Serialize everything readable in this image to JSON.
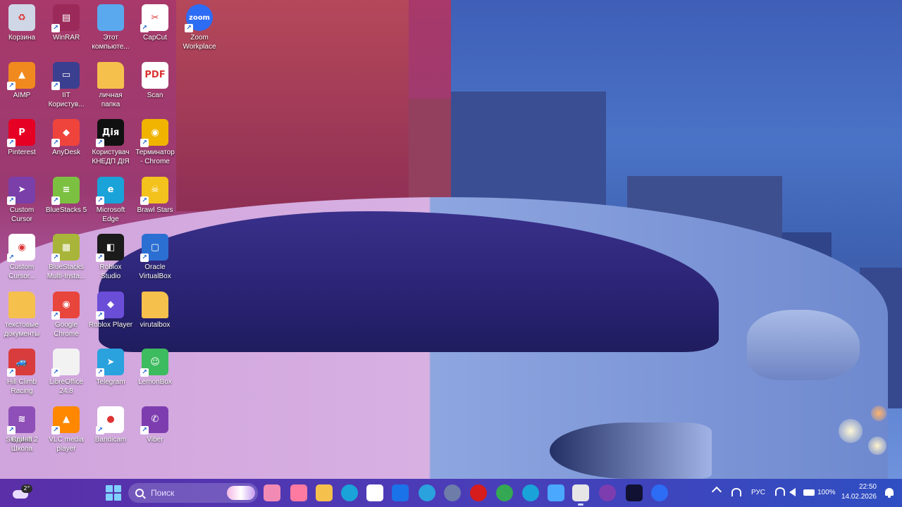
{
  "desktop": {
    "icons": [
      {
        "label": "Корзина",
        "icon": "recycle-bin-icon",
        "color": "#cfd6e6",
        "text": "♻",
        "shortcut": false
      },
      {
        "label": "WinRAR",
        "icon": "winrar-icon",
        "color": "#9b2a5a",
        "text": "▤",
        "shortcut": true
      },
      {
        "label": "Этот\nкомпьюте...",
        "icon": "this-pc-icon",
        "color": "#5aa9ef",
        "text": "",
        "shortcut": false
      },
      {
        "label": "CapCut",
        "icon": "capcut-icon",
        "color": "#ffffff",
        "text": "✂",
        "shortcut": true
      },
      {
        "label": "Zoom\nWorkplace",
        "icon": "zoom-icon",
        "color": "#2d6cf5",
        "text": "zoom",
        "shortcut": true
      },
      {
        "label": "AIMP",
        "icon": "aimp-icon",
        "color": "#f18a1e",
        "text": "▲",
        "shortcut": true
      },
      {
        "label": "IIT\nКористув...",
        "icon": "iit-user-icon",
        "color": "#3b3f8f",
        "text": "▭",
        "shortcut": true
      },
      {
        "label": "личная\nпапка",
        "icon": "folder-icon",
        "color": "#f6c04d",
        "text": "",
        "shortcut": false
      },
      {
        "label": "Scan",
        "icon": "pdf-file-icon",
        "color": "#ffffff",
        "text": "PDF",
        "shortcut": false
      },
      {
        "label": "Pinterest",
        "icon": "pinterest-icon",
        "color": "#e60023",
        "text": "P",
        "shortcut": true
      },
      {
        "label": "AnyDesk",
        "icon": "anydesk-icon",
        "color": "#ef443b",
        "text": "◆",
        "shortcut": true
      },
      {
        "label": "Користувач\nКНЕДП ДІЯ",
        "icon": "diia-icon",
        "color": "#111111",
        "text": "Дія",
        "shortcut": true
      },
      {
        "label": "Терминатор\n- Chrome",
        "icon": "chrome-icon",
        "color": "#f0b400",
        "text": "◉",
        "shortcut": true
      },
      {
        "label": "Custom\nCursor",
        "icon": "custom-cursor-icon",
        "color": "#7a3fa8",
        "text": "➤",
        "shortcut": true
      },
      {
        "label": "BlueStacks 5",
        "icon": "bluestacks-icon",
        "color": "#7cc041",
        "text": "≡",
        "shortcut": true
      },
      {
        "label": "Microsoft\nEdge",
        "icon": "edge-icon",
        "color": "#1aa3d8",
        "text": "e",
        "shortcut": true
      },
      {
        "label": "Brawl Stars",
        "icon": "brawl-stars-icon",
        "color": "#f3c21c",
        "text": "☠",
        "shortcut": true
      },
      {
        "label": "Custom\nCursor...",
        "icon": "chrome-doc-icon",
        "color": "#ffffff",
        "text": "◉",
        "shortcut": true
      },
      {
        "label": "BlueStacks\nMulti-Insta...",
        "icon": "bluestacks-multi-icon",
        "color": "#a8b53a",
        "text": "▦",
        "shortcut": true
      },
      {
        "label": "Roblox\nStudio",
        "icon": "roblox-studio-icon",
        "color": "#1b1b1b",
        "text": "◧",
        "shortcut": true
      },
      {
        "label": "Oracle\nVirtualBox",
        "icon": "virtualbox-icon",
        "color": "#2c6fd2",
        "text": "▢",
        "shortcut": true
      },
      {
        "label": "текстовые\nдокументы",
        "icon": "folder-icon",
        "color": "#f6c04d",
        "text": "",
        "shortcut": false
      },
      {
        "label": "Google\nChrome",
        "icon": "chrome-icon",
        "color": "#e8453c",
        "text": "◉",
        "shortcut": true
      },
      {
        "label": "Roblox Player",
        "icon": "roblox-player-icon",
        "color": "#6b4ed8",
        "text": "◆",
        "shortcut": true
      },
      {
        "label": "virutalbox",
        "icon": "folder-icon",
        "color": "#f6c04d",
        "text": "",
        "shortcut": false
      },
      {
        "label": "Hill Climb\nRacing",
        "icon": "hill-climb-icon",
        "color": "#d93c3c",
        "text": "🚙",
        "shortcut": true
      },
      {
        "label": "LibreOffice\n24.8",
        "icon": "libreoffice-icon",
        "color": "#f2f2f2",
        "text": "",
        "shortcut": true
      },
      {
        "label": "Telegram",
        "icon": "telegram-icon",
        "color": "#2aa2de",
        "text": "➤",
        "shortcut": true
      },
      {
        "label": "LemonBox",
        "icon": "lemonbox-icon",
        "color": "#3dbb5f",
        "text": "☺",
        "shortcut": true
      },
      {
        "label": "Standoff 2",
        "icon": "standoff-icon",
        "color": "#b5303a",
        "text": "☻",
        "shortcut": true
      },
      {
        "label": "VLC media\nplayer",
        "icon": "vlc-icon",
        "color": "#ff8800",
        "text": "▲",
        "shortcut": true
      },
      {
        "label": "Bandicam",
        "icon": "bandicam-icon",
        "color": "#ffffff",
        "text": "●",
        "shortcut": true
      },
      {
        "label": "Viber",
        "icon": "viber-icon",
        "color": "#7d3daf",
        "text": "✆",
        "shortcut": true
      },
      {
        "label": "Єдина\nШкола",
        "icon": "edyna-shkola-icon",
        "color": "#8e4fb8",
        "text": "≋",
        "shortcut": true
      }
    ]
  },
  "taskbar": {
    "widget_badge": "2°",
    "search_placeholder": "Поиск",
    "apps": [
      {
        "icon": "task-view-icon",
        "color": "#f28bb3"
      },
      {
        "icon": "copilot-icon",
        "color": "#ff7aa0"
      },
      {
        "icon": "file-explorer-icon",
        "color": "#f6c04d"
      },
      {
        "icon": "edge-icon",
        "color": "#1aa3d8"
      },
      {
        "icon": "microsoft-store-icon",
        "color": "#ffffff"
      },
      {
        "icon": "outlook-icon",
        "color": "#1a73e8"
      },
      {
        "icon": "telegram-icon",
        "color": "#2aa2de"
      },
      {
        "icon": "settings-icon",
        "color": "#6d7ca8"
      },
      {
        "icon": "bandicam-icon",
        "color": "#d61c1c"
      },
      {
        "icon": "chrome-icon",
        "color": "#34a853"
      },
      {
        "icon": "edge-dev-icon",
        "color": "#1aa3d8"
      },
      {
        "icon": "onedrive-icon",
        "color": "#4aa8ff"
      },
      {
        "icon": "notepad-icon",
        "color": "#e6e6e6"
      },
      {
        "icon": "viber-icon",
        "color": "#7d3daf"
      },
      {
        "icon": "custom-cursor-icon",
        "color": "#111133"
      },
      {
        "icon": "zoom-icon",
        "color": "#2d6cf5"
      }
    ],
    "tray": {
      "language": "РУС",
      "battery": "100%",
      "time": "22:50",
      "date": "14.02.2026"
    }
  }
}
